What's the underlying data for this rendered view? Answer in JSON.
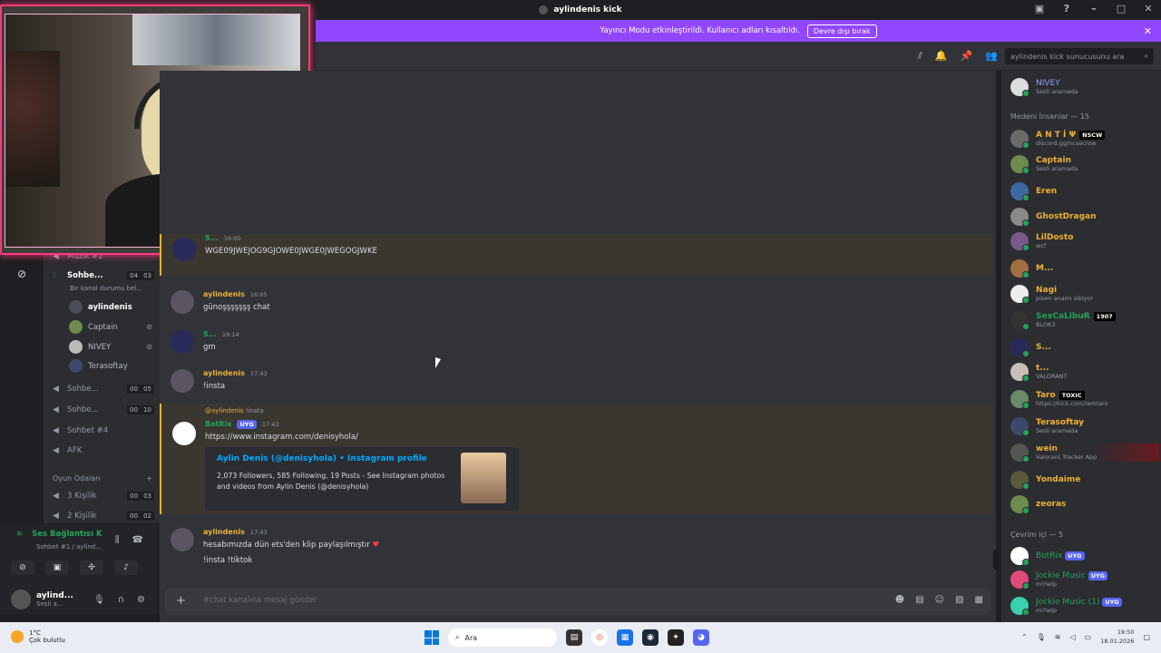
{
  "window": {
    "title": "aylindenis kick"
  },
  "banner": {
    "text": "Yayıncı Modu etkinleştirildi. Kullanıcı adları kısaltıldı.",
    "button": "Devre dışı bırak"
  },
  "toolbar": {
    "search_placeholder": "aylindenis kick sunucusunu ara"
  },
  "channels": {
    "top_partial": "Müzik #2",
    "active": {
      "name": "Sohbe...",
      "count_a": "04",
      "count_b": "03",
      "status": "Bir kanal durumu bel..."
    },
    "voice_users": [
      {
        "name": "aylindenis"
      },
      {
        "name": "Captain"
      },
      {
        "name": "NIVEY"
      },
      {
        "name": "Terasoftay"
      }
    ],
    "others": [
      {
        "name": "Sohbe...",
        "a": "00",
        "b": "05"
      },
      {
        "name": "Sohbe...",
        "a": "00",
        "b": "10"
      },
      {
        "name": "Sohbet #4"
      },
      {
        "name": "AFK"
      }
    ],
    "category": "Oyun Odaları",
    "games": [
      {
        "name": "3 Kişilik",
        "a": "00",
        "b": "03"
      },
      {
        "name": "2 Kişilik",
        "a": "00",
        "b": "02"
      }
    ]
  },
  "voice_panel": {
    "status": "Ses Bağlantısı K",
    "sub": "Sohbet #1 / aylind...",
    "username": "aylind...",
    "user_status": "Sesli a..."
  },
  "messages": [
    {
      "user": "S...",
      "time": "16:00",
      "text": "WGE09JWEJOG9GJOWE0JWGE0JWEGOGJWKE"
    },
    {
      "user": "aylindenis",
      "time": "16:05",
      "text": "günoşşşşşşş chat"
    },
    {
      "user": "S...",
      "time": "16:14",
      "text": "gm"
    },
    {
      "user": "aylindenis",
      "time": "17:43",
      "text": "!insta"
    },
    {
      "reply_to": "@aylindenis",
      "reply_text": "!insta",
      "user": "BotRix",
      "badge": "UYG",
      "time": "17:43",
      "link": "https://www.instagram.com/denisyhola/",
      "embed_title": "Aylin Denis (@denisyhola) • Instagram profile",
      "embed_desc": "2,073 Followers, 585 Following, 19 Posts - See Instagram photos and videos from Aylin Denis (@denisyhola)"
    },
    {
      "user": "aylindenis",
      "time": "17:43",
      "text": "hesabımızda dün ets'den klip paylaşılmıştır",
      "text2": "!insta !tiktok"
    }
  ],
  "composer": {
    "placeholder": "#chat kanalına mesaj gönder"
  },
  "members": {
    "top": {
      "name": "NIVEY",
      "status": "Sesli aramada"
    },
    "group1": "Medeni İnsanlar — 15",
    "list1": [
      {
        "name": "A N T İ Ψ",
        "status": "discord.gg/ncsecrow",
        "tag": "NSCW"
      },
      {
        "name": "Captain",
        "status": "Sesli aramada"
      },
      {
        "name": "Eren",
        "status": ""
      },
      {
        "name": "GhostDragan",
        "status": ""
      },
      {
        "name": "LilDosto",
        "status": "wcf"
      },
      {
        "name": "M...",
        "status": ""
      },
      {
        "name": "Nagi",
        "status": "pisen anamı sikiyor"
      },
      {
        "name": "SexCaLibuR",
        "status": "BLOK3",
        "tag": "1907"
      },
      {
        "name": "S...",
        "status": ""
      },
      {
        "name": "t...",
        "status": "VALORANT"
      },
      {
        "name": "Taro",
        "status": "https://kick.com/iamtaro",
        "tag": "TOXIC"
      },
      {
        "name": "Terasoftay",
        "status": "Sesli aramada"
      },
      {
        "name": "wein",
        "status": "Valorant Tracker App"
      },
      {
        "name": "Yondaime",
        "status": ""
      },
      {
        "name": "zeoras",
        "status": ""
      }
    ],
    "group2": "Çevrim içi — 5",
    "list2": [
      {
        "name": "BotRix",
        "status": "",
        "tag": "UYG"
      },
      {
        "name": "Jockie Music",
        "status": "m!help",
        "tag": "UYG"
      },
      {
        "name": "Jockie Music (1)",
        "status": "m!help",
        "tag": "UYG"
      }
    ]
  },
  "taskbar": {
    "temp": "1°C",
    "weather": "Çok bulutlu",
    "search": "Ara",
    "time": "19:50",
    "date": "18.01.2026"
  }
}
